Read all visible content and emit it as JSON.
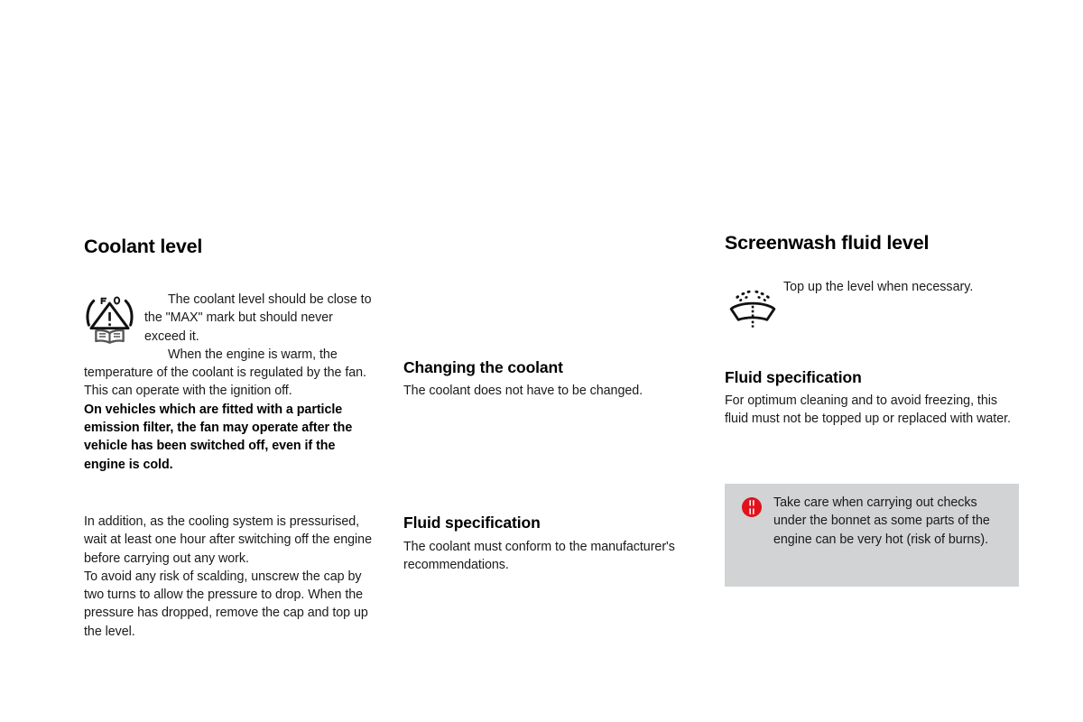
{
  "page": {
    "background": "#ffffff",
    "callout_background": "#d1d3d4",
    "warning_icon_color": "#e1121c"
  },
  "left_column": {
    "heading": "Coolant level",
    "icon_name": "warning-triangle-manual-icon",
    "paragraph_1": "The coolant level should be close to the \"MAX\" mark but should never exceed it.",
    "paragraph_2": "When the engine is warm, the temperature of the coolant is regulated by the fan. This can operate with the ignition off.",
    "paragraph_3_bold": "On vehicles which are fitted with a particle emission filter, the fan may operate after the vehicle has been switched off, even if the engine is cold.",
    "paragraph_4": "In addition, as the cooling system is pressurised, wait at least one hour after switching off the engine before carrying out any work.",
    "paragraph_5": "To avoid any risk of scalding, unscrew the cap by two turns to allow the pressure to drop. When the pressure has dropped, remove the cap and top up the level."
  },
  "middle_column": {
    "heading_1": "Changing the coolant",
    "body_1": "The coolant does not have to be changed.",
    "heading_2": "Fluid specification",
    "body_2": "The coolant must conform to the manufacturer's recommendations."
  },
  "right_column": {
    "heading": "Screenwash fluid level",
    "icon_name": "windscreen-washer-icon",
    "intro": "Top up the level when necessary.",
    "heading_2": "Fluid specification",
    "body_2": "For optimum cleaning and to avoid freezing, this fluid must not be topped up or replaced with water."
  },
  "callout": {
    "icon_name": "red-warning-icon",
    "text": "Take care when carrying out checks under the bonnet as some parts of the engine can be very hot (risk of burns)."
  }
}
